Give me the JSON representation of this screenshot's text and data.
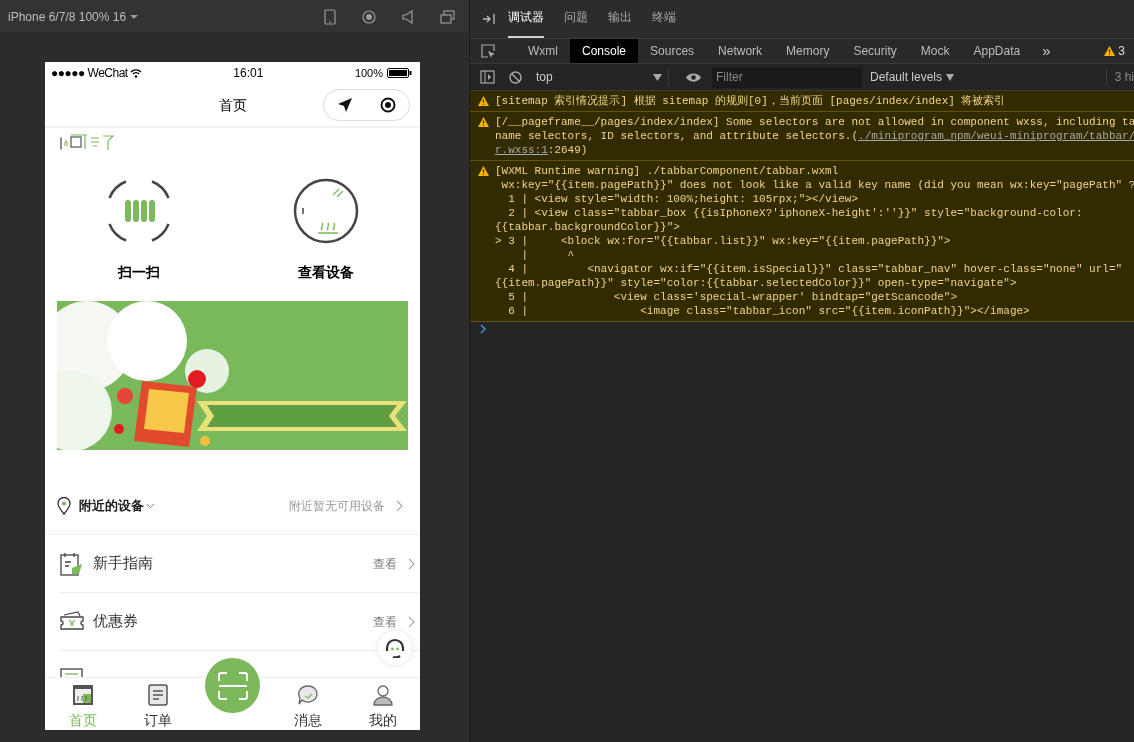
{
  "simulator": {
    "device_label": "iPhone 6/7/8 100% 16"
  },
  "phone": {
    "status_bar": {
      "carrier": "●●●●● WeChat",
      "time": "16:01",
      "battery": "100%"
    },
    "nav": {
      "title": "首页"
    },
    "actions": [
      {
        "kind": "scan",
        "label": "扫一扫"
      },
      {
        "kind": "device",
        "label": "查看设备"
      }
    ],
    "nearby": {
      "label": "附近的设备",
      "value": "附近暂无可用设备"
    },
    "menu": [
      {
        "kind": "guide",
        "label": "新手指南",
        "action": "查看"
      },
      {
        "kind": "coupon",
        "label": "优惠券",
        "action": "查看"
      },
      {
        "kind": "order"
      }
    ],
    "tabbar": [
      {
        "kind": "home",
        "label": "首页",
        "selected": true
      },
      {
        "kind": "order",
        "label": "订单",
        "selected": false
      },
      {
        "kind": "scan",
        "selected": false
      },
      {
        "kind": "message",
        "label": "消息",
        "selected": false
      },
      {
        "kind": "me",
        "label": "我的",
        "selected": false
      }
    ]
  },
  "devtools": {
    "panel_tabs": [
      {
        "label": "调试器",
        "selected": true
      },
      {
        "label": "问题",
        "selected": false
      },
      {
        "label": "输出",
        "selected": false
      },
      {
        "label": "终端",
        "selected": false
      }
    ],
    "tool_tabs": [
      {
        "label": "Wxml",
        "selected": false
      },
      {
        "label": "Console",
        "selected": true
      },
      {
        "label": "Sources",
        "selected": false
      },
      {
        "label": "Network",
        "selected": false
      },
      {
        "label": "Memory",
        "selected": false
      },
      {
        "label": "Security",
        "selected": false
      },
      {
        "label": "Mock",
        "selected": false
      },
      {
        "label": "AppData",
        "selected": false
      }
    ],
    "more": "»",
    "warning_count": "3",
    "context": "top",
    "filter": {
      "placeholder": "Filter"
    },
    "levels": "Default levels",
    "hidden": "3 hi",
    "messages": [
      {
        "kind": "warning",
        "lines": [
          [
            {
              "text": "[sitemap 索引情况提示] 根据 sitemap 的规则[0]，当前页面 [pages/index/index] 将被索引",
              "link": false
            }
          ]
        ]
      },
      {
        "kind": "warning",
        "lines": [
          [
            {
              "text": "[/__pageframe__/pages/index/index] Some selectors are not allowed in component wxss, including ta",
              "link": false
            }
          ],
          [
            {
              "text": "name selectors, ID selectors, and attribute selectors.(",
              "link": false
            },
            {
              "text": "./miniprogram_npm/weui-miniprogram/tabbar/",
              "link": true
            }
          ],
          [
            {
              "text": "r.wxss:1",
              "link": true
            },
            {
              "text": ":2649)",
              "link": false
            }
          ]
        ]
      },
      {
        "kind": "warning",
        "lines": [
          [
            {
              "text": "[WXML Runtime warning] ./tabbarComponent/tabbar.wxml",
              "link": false
            }
          ],
          [
            {
              "text": " wx:key=\"{{item.pagePath}}\" does not look like a valid key name (did you mean wx:key=\"pagePath\" ?",
              "link": false
            }
          ],
          [
            {
              "text": "  1 | <view style=\"width: 100%;height: 105rpx;\"></view>",
              "link": false
            }
          ],
          [
            {
              "text": "  2 | <view class=\"tabbar_box {{isIphoneX?'iphoneX-height':''}}\" style=\"background-color:",
              "link": false
            }
          ],
          [
            {
              "text": "{{tabbar.backgroundColor}}\">",
              "link": false
            }
          ],
          [
            {
              "text": "> 3 |     <block wx:for=\"{{tabbar.list}}\" wx:key=\"{{item.pagePath}}\">",
              "link": false
            }
          ],
          [
            {
              "text": "    |      ^",
              "link": false
            }
          ],
          [
            {
              "text": "  4 |         <navigator wx:if=\"{{item.isSpecial}}\" class=\"tabbar_nav\" hover-class=\"none\" url=\"",
              "link": false
            }
          ],
          [
            {
              "text": "{{item.pagePath}}\" style=\"color:{{tabbar.selectedColor}}\" open-type=\"navigate\">",
              "link": false
            }
          ],
          [
            {
              "text": "  5 |             <view class='special-wrapper' bindtap=\"getScancode\">",
              "link": false
            }
          ],
          [
            {
              "text": "  6 |                 <image class=\"tabbar_icon\" src=\"{{item.iconPath}}\"></image>",
              "link": false
            }
          ]
        ]
      }
    ]
  }
}
